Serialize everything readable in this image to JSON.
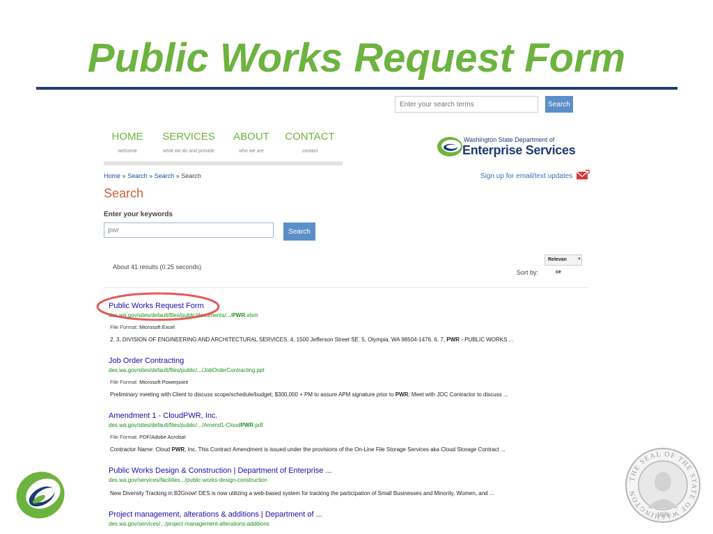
{
  "slide": {
    "title": "Public Works Request Form"
  },
  "site_header": {
    "search_placeholder": "Enter your search terms",
    "search_button": "Search",
    "nav": [
      {
        "label": "HOME",
        "sub": "welcome"
      },
      {
        "label": "SERVICES",
        "sub": "what we do and provide"
      },
      {
        "label": "ABOUT",
        "sub": "who we are"
      },
      {
        "label": "CONTACT",
        "sub": "contact"
      }
    ],
    "logo_line1": "Washington State Department of",
    "logo_line2": "Enterprise Services",
    "signup": "Sign up for email/text updates"
  },
  "breadcrumb": {
    "items": [
      "Home",
      "Search",
      "Search",
      "Search"
    ],
    "sep": "»"
  },
  "search_page": {
    "heading": "Search",
    "keywords_label": "Enter your keywords",
    "keywords_value": "pwr",
    "search_button": "Search",
    "results_count": "About 41 results (0.25 seconds)",
    "sort_label": "Sort by:",
    "sort_value_line1": "Relevan",
    "sort_value_line2": "ce"
  },
  "results": [
    {
      "title": "Public Works Request Form",
      "url_prefix": "des.wa.gov/sites/default/files/public/documents/.../",
      "url_bold": "PWR",
      "url_suffix": ".xlsm",
      "format_label": "File Format:",
      "format": "Microsoft Excel",
      "snippet_before": "2. 3, DIVISION OF ENGINEERING AND ARCHITECTURAL SERVICES. 4, 1500 Jefferson Street SE. 5, Olympia, WA 98504-1476. 6. 7, ",
      "snippet_bold": "PWR",
      "snippet_after": " - PUBLIC WORKS ...",
      "highlighted": true
    },
    {
      "title": "Job Order Contracting",
      "url_prefix": "des.wa.gov/sites/default/files/public/.../JobOrderContracting.ppt",
      "url_bold": "",
      "url_suffix": "",
      "format_label": "File Format:",
      "format": "Microsoft Powerpoint",
      "snippet_before": "Preliminary meeting with Client to discuss scope/schedule/budget; $300,000 + PM to assure APM signature prior to ",
      "snippet_bold": "PWR",
      "snippet_after": "; Meet with JOC Contractor to discuss ...",
      "highlighted": false
    },
    {
      "title": "Amendment 1 - CloudPWR, Inc.",
      "url_prefix": "des.wa.gov/sites/default/files/public/.../Amend1-Cloud",
      "url_bold": "PWR",
      "url_suffix": ".pdf",
      "format_label": "File Format:",
      "format": "PDF/Adobe Acrobat",
      "snippet_before": "Contractor Name: Cloud ",
      "snippet_bold": "PWR",
      "snippet_after": ", Inc. This Contract Amendment is issued under the provisions of the On-Line File Storage Services aka Cloud Storage Contract ...",
      "highlighted": false
    },
    {
      "title": "Public Works Design & Construction | Department of Enterprise ...",
      "url_prefix": "des.wa.gov/services/facilities.../public-works-design-construction",
      "url_bold": "",
      "url_suffix": "",
      "format_label": "",
      "format": "",
      "snippet_before": "New Diversity Tracking in B2Gnow! DES is now utilizing a web-based system for tracking the participation of Small Businesses and Minority, Women, and ...",
      "snippet_bold": "",
      "snippet_after": "",
      "highlighted": false
    },
    {
      "title": "Project management, alterations & additions | Department of ...",
      "url_prefix": "des.wa.gov/services/.../project-management-alterations-additions",
      "url_bold": "",
      "url_suffix": "",
      "format_label": "",
      "format": "",
      "snippet_before": "",
      "snippet_bold": "",
      "snippet_after": "",
      "highlighted": false
    }
  ],
  "seal": {
    "top_text": "THE SEAL OF THE STATE OF WASHINGTON",
    "year": "1889"
  },
  "colors": {
    "title_green": "#6db33f",
    "navy": "#1f3b73",
    "link": "#1a0dab",
    "url_green": "#1a8f1a",
    "button_blue": "#5b8fc9",
    "heading_orange": "#c8643b",
    "highlight_red": "#e03c3c"
  }
}
